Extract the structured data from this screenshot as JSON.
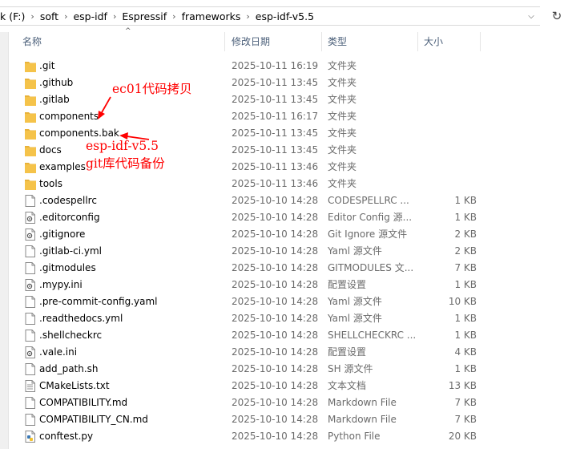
{
  "address": {
    "crumbs": [
      "k (F:)",
      "soft",
      "esp-idf",
      "Espressif",
      "frameworks",
      "esp-idf-v5.5"
    ]
  },
  "columns": {
    "name": "名称",
    "modified": "修改日期",
    "type": "类型",
    "size": "大小"
  },
  "files": [
    {
      "name": ".git",
      "date": "2025-10-11 16:19",
      "type": "文件夹",
      "size": "",
      "icon": "folder"
    },
    {
      "name": ".github",
      "date": "2025-10-11 13:45",
      "type": "文件夹",
      "size": "",
      "icon": "folder"
    },
    {
      "name": ".gitlab",
      "date": "2025-10-11 13:45",
      "type": "文件夹",
      "size": "",
      "icon": "folder"
    },
    {
      "name": "components",
      "date": "2025-10-11 16:17",
      "type": "文件夹",
      "size": "",
      "icon": "folder"
    },
    {
      "name": "components.bak",
      "date": "2025-10-11 13:45",
      "type": "文件夹",
      "size": "",
      "icon": "folder"
    },
    {
      "name": "docs",
      "date": "2025-10-11 13:45",
      "type": "文件夹",
      "size": "",
      "icon": "folder"
    },
    {
      "name": "examples",
      "date": "2025-10-11 13:46",
      "type": "文件夹",
      "size": "",
      "icon": "folder"
    },
    {
      "name": "tools",
      "date": "2025-10-11 13:46",
      "type": "文件夹",
      "size": "",
      "icon": "folder"
    },
    {
      "name": ".codespellrc",
      "date": "2025-10-10 14:28",
      "type": "CODESPELLRC ...",
      "size": "1 KB",
      "icon": "file"
    },
    {
      "name": ".editorconfig",
      "date": "2025-10-10 14:28",
      "type": "Editor Config 源...",
      "size": "1 KB",
      "icon": "gear-file"
    },
    {
      "name": ".gitignore",
      "date": "2025-10-10 14:28",
      "type": "Git Ignore 源文件",
      "size": "2 KB",
      "icon": "gear-file"
    },
    {
      "name": ".gitlab-ci.yml",
      "date": "2025-10-10 14:28",
      "type": "Yaml 源文件",
      "size": "2 KB",
      "icon": "file"
    },
    {
      "name": ".gitmodules",
      "date": "2025-10-10 14:28",
      "type": "GITMODULES 文...",
      "size": "7 KB",
      "icon": "file"
    },
    {
      "name": ".mypy.ini",
      "date": "2025-10-10 14:28",
      "type": "配置设置",
      "size": "1 KB",
      "icon": "gear-file"
    },
    {
      "name": ".pre-commit-config.yaml",
      "date": "2025-10-10 14:28",
      "type": "Yaml 源文件",
      "size": "10 KB",
      "icon": "file"
    },
    {
      "name": ".readthedocs.yml",
      "date": "2025-10-10 14:28",
      "type": "Yaml 源文件",
      "size": "1 KB",
      "icon": "file"
    },
    {
      "name": ".shellcheckrc",
      "date": "2025-10-10 14:28",
      "type": "SHELLCHECKRC ...",
      "size": "1 KB",
      "icon": "file"
    },
    {
      "name": ".vale.ini",
      "date": "2025-10-10 14:28",
      "type": "配置设置",
      "size": "4 KB",
      "icon": "gear-file"
    },
    {
      "name": "add_path.sh",
      "date": "2025-10-10 14:28",
      "type": "SH 源文件",
      "size": "1 KB",
      "icon": "file"
    },
    {
      "name": "CMakeLists.txt",
      "date": "2025-10-10 14:28",
      "type": "文本文档",
      "size": "13 KB",
      "icon": "text-file"
    },
    {
      "name": "COMPATIBILITY.md",
      "date": "2025-10-10 14:28",
      "type": "Markdown File",
      "size": "7 KB",
      "icon": "file"
    },
    {
      "name": "COMPATIBILITY_CN.md",
      "date": "2025-10-10 14:28",
      "type": "Markdown File",
      "size": "7 KB",
      "icon": "file"
    },
    {
      "name": "conftest.py",
      "date": "2025-10-10 14:28",
      "type": "Python File",
      "size": "20 KB",
      "icon": "python-file"
    }
  ],
  "selected_index": 4,
  "annotations": {
    "top": "ec01代码拷贝",
    "bottom_line1": "esp-idf-v5.5",
    "bottom_line2": "git库代码备份",
    "color": "#ff0000"
  },
  "colors": {
    "folder": "#f5c34a",
    "header_text": "#4c607a",
    "selected_row": "#d9d9d9"
  }
}
